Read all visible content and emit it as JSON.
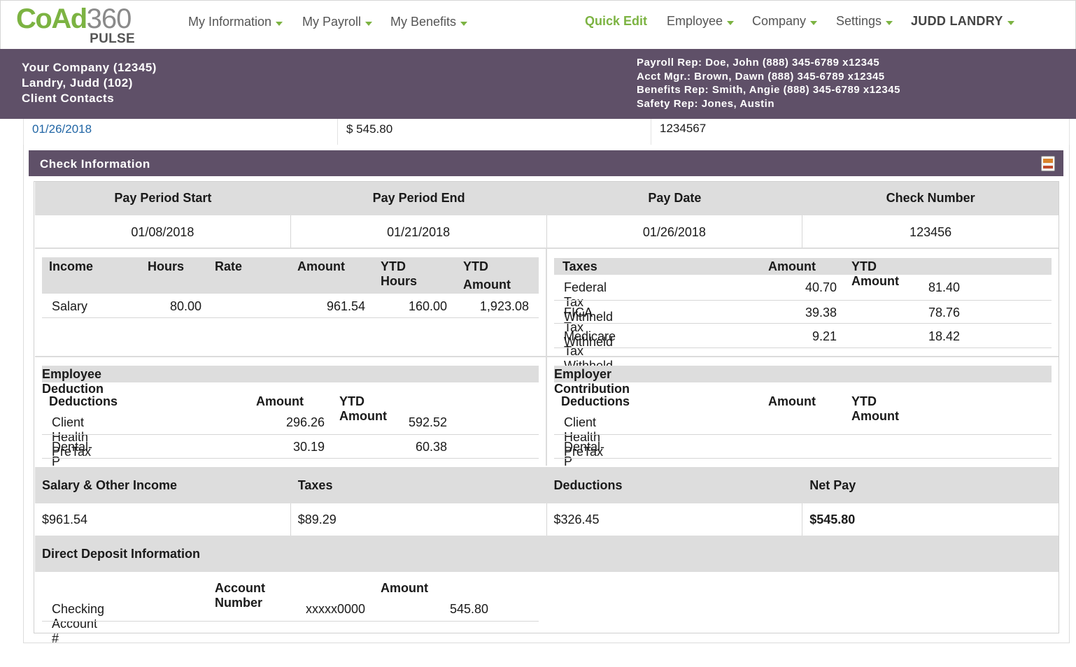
{
  "nav": {
    "logo_main": "CoAd",
    "logo_num": "360",
    "logo_sub": "PULSE",
    "my_information": "My Information",
    "my_payroll": "My Payroll",
    "my_benefits": "My Benefits",
    "quick_edit": "Quick Edit",
    "employee": "Employee",
    "company": "Company",
    "settings": "Settings",
    "user": "JUDD LANDRY"
  },
  "header": {
    "company": "Your Company (12345)",
    "employee": "Landry, Judd (102)",
    "client_contacts": "Client Contacts",
    "payroll_rep": "Payroll Rep: Doe, John (888) 345-6789 x12345",
    "acct_mgr": "Acct Mgr.: Brown, Dawn (888) 345-6789 x12345",
    "benefits_rep": "Benefits Rep: Smith, Angie (888) 345-6789 x12345",
    "safety_rep": "Safety Rep: Jones, Austin"
  },
  "prev_row": {
    "date": "01/26/2018",
    "amount": "$ 545.80",
    "number": "1234567"
  },
  "panel": {
    "title": "Check Information"
  },
  "period": {
    "headers": [
      "Pay Period Start",
      "Pay Period End",
      "Pay Date",
      "Check Number"
    ],
    "values": [
      "01/08/2018",
      "01/21/2018",
      "01/26/2018",
      "123456"
    ]
  },
  "income": {
    "headers": {
      "income": "Income",
      "hours": "Hours",
      "rate": "Rate",
      "amount": "Amount",
      "ytd_hours": "YTD Hours",
      "ytd_amount_1": "YTD",
      "ytd_amount_2": "Amount"
    },
    "rows": [
      {
        "name": "Salary",
        "hours": "80.00",
        "rate": "",
        "amount": "961.54",
        "ytd_hours": "160.00",
        "ytd_amount": "1,923.08"
      }
    ]
  },
  "taxes": {
    "headers": {
      "taxes": "Taxes",
      "amount": "Amount",
      "ytd_amount": "YTD Amount"
    },
    "rows": [
      {
        "name": "Federal Tax Withheld",
        "amount": "40.70",
        "ytd": "81.40"
      },
      {
        "name": "FICA Tax Withheld",
        "amount": "39.38",
        "ytd": "78.76"
      },
      {
        "name": "Medicare Tax Withheld",
        "amount": "9.21",
        "ytd": "18.42"
      }
    ]
  },
  "employee_deduction": {
    "title": "Employee Deduction",
    "headers": {
      "deductions": "Deductions",
      "amount": "Amount",
      "ytd_amount": "YTD Amount"
    },
    "rows": [
      {
        "name": "Client Health PreTax",
        "amount": "296.26",
        "ytd": "592.52"
      },
      {
        "name": "Dental-P",
        "amount": "30.19",
        "ytd": "60.38"
      }
    ]
  },
  "employer_contribution": {
    "title": "Employer Contribution",
    "headers": {
      "deductions": "Deductions",
      "amount": "Amount",
      "ytd_amount": "YTD Amount"
    },
    "rows": [
      {
        "name": "Client Health PreTax",
        "amount": "",
        "ytd": ""
      },
      {
        "name": "Dental-P",
        "amount": "",
        "ytd": ""
      }
    ]
  },
  "summary": {
    "headers": [
      "Salary & Other Income",
      "Taxes",
      "Deductions",
      "Net Pay"
    ],
    "values": [
      "$961.54",
      "$89.29",
      "$326.45",
      "$545.80"
    ]
  },
  "direct_deposit": {
    "title": "Direct Deposit Information",
    "headers": {
      "account_number": "Account Number",
      "amount": "Amount"
    },
    "rows": [
      {
        "name": "Checking Account #",
        "account": "xxxxx0000",
        "amount": "545.80"
      }
    ]
  },
  "colors": {
    "brand_green": "#7cb342",
    "header_purple": "#5f5068",
    "table_grey": "#dddddd",
    "link_blue": "#2166a5"
  }
}
